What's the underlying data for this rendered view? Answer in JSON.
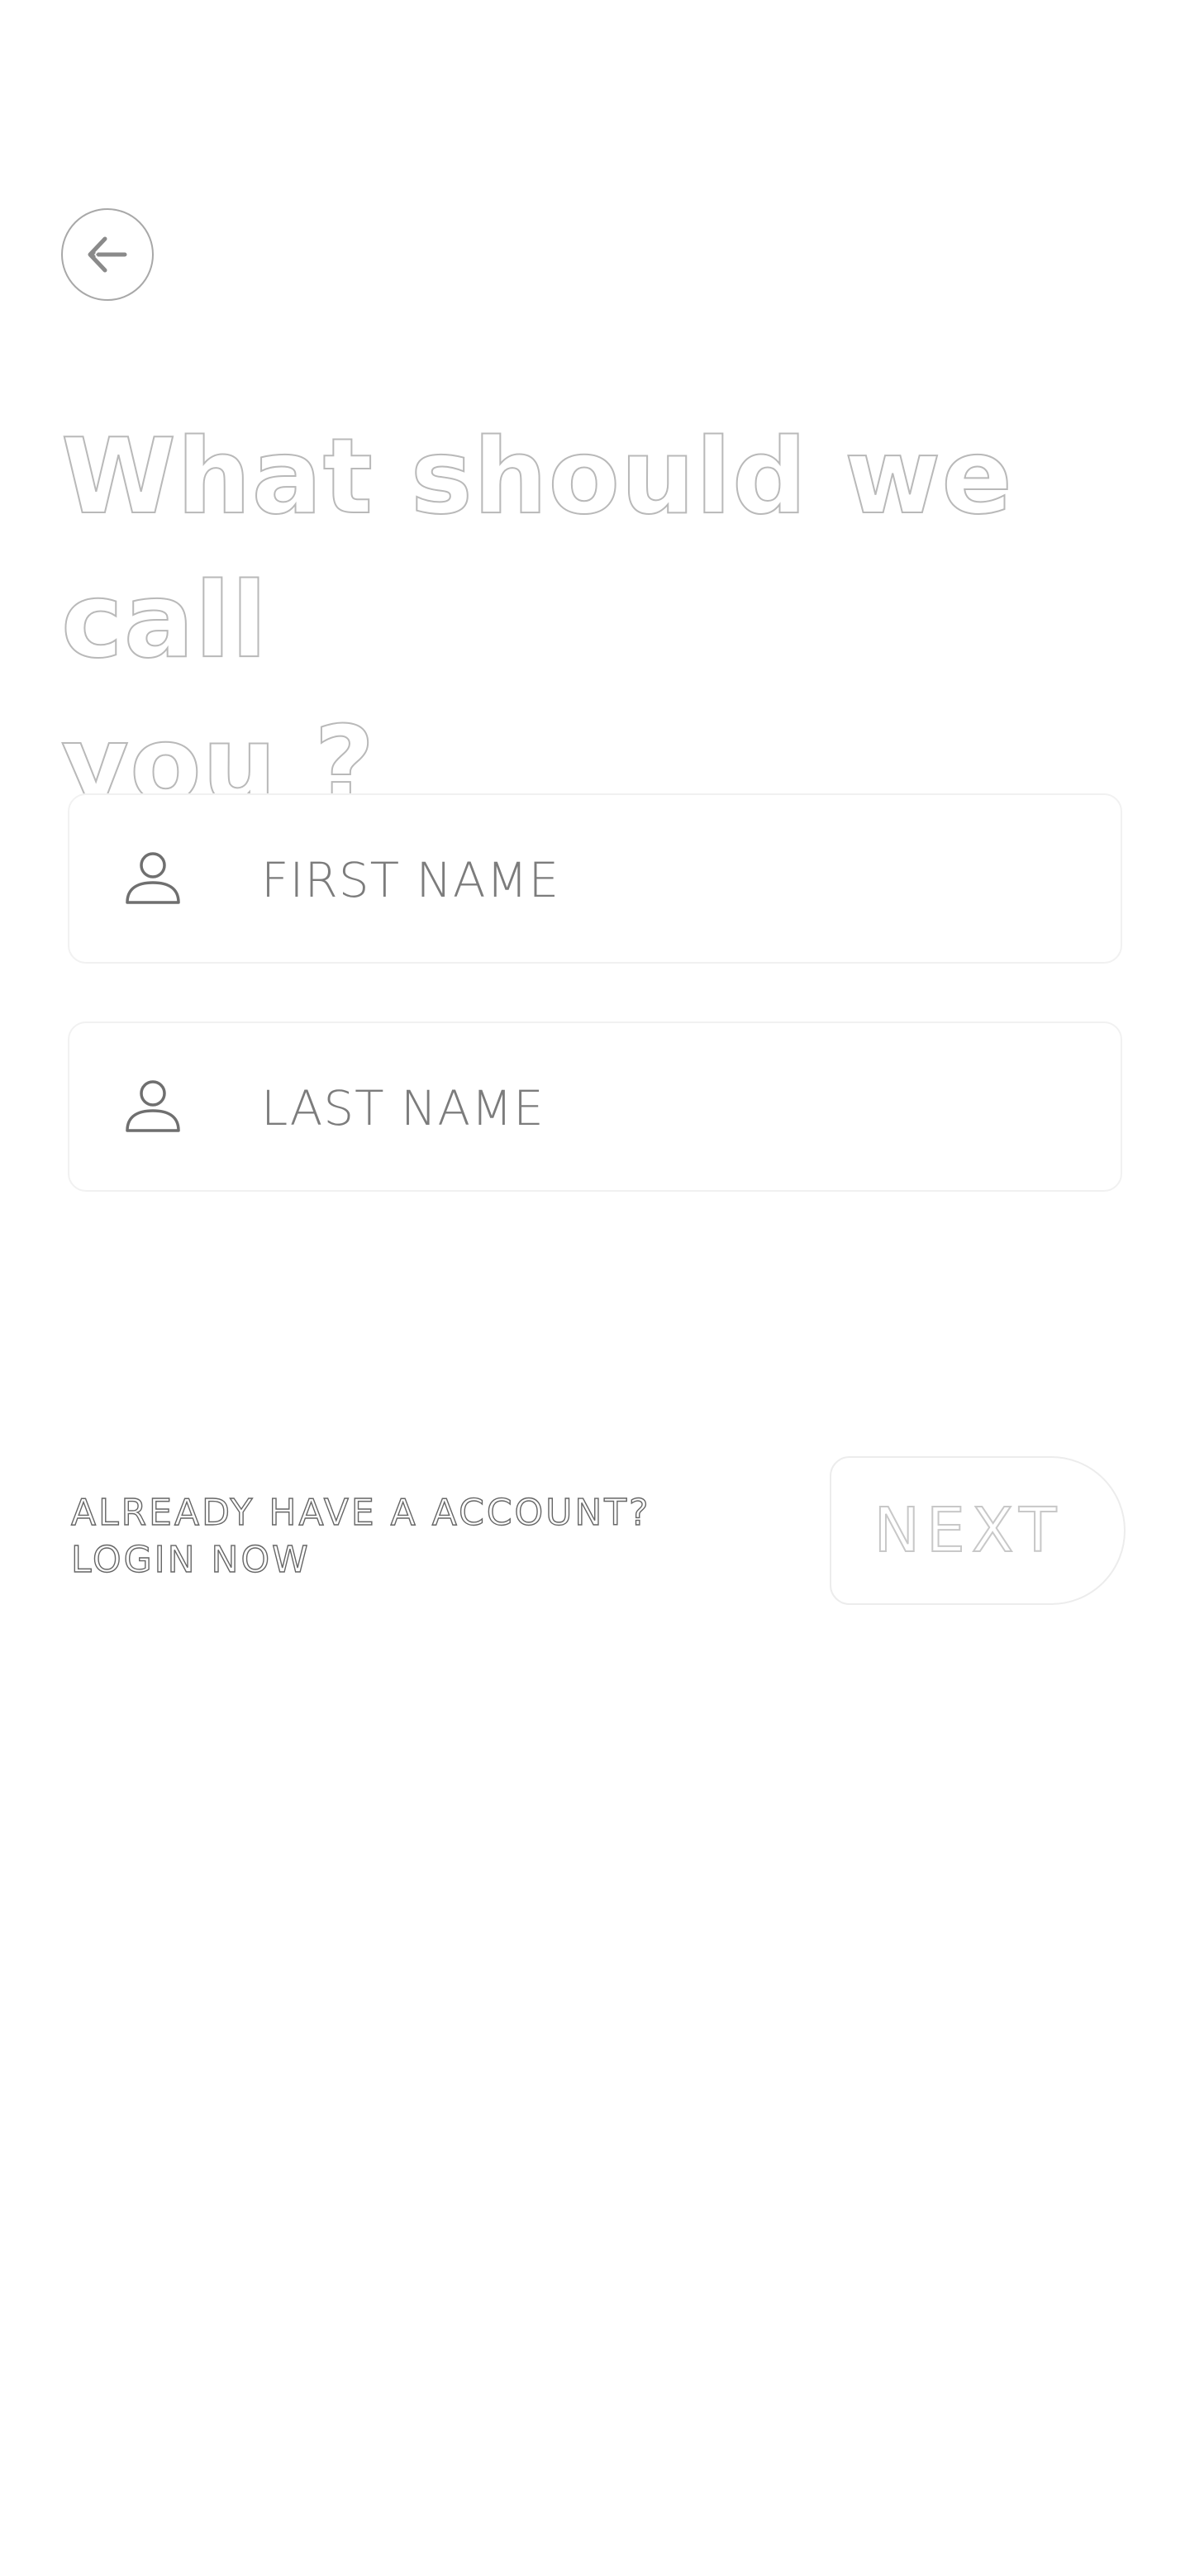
{
  "back_button": {
    "icon": "arrow-left-icon"
  },
  "title": {
    "text": "What should we call\n you ?"
  },
  "form": {
    "first_name": {
      "icon": "user-icon",
      "placeholder": "FIRST NAME",
      "value": ""
    },
    "last_name": {
      "icon": "user-icon",
      "placeholder": "LAST NAME",
      "value": ""
    }
  },
  "footer": {
    "account_question": "ALREADY HAVE A ACCOUNT?",
    "login_link": "LOGIN NOW",
    "next_label": "NEXT"
  },
  "colors": {
    "outline_text": "#b9b9b9",
    "placeholder": "#7c7c7c",
    "field_border": "#f1f1f1",
    "background": "#ffffff"
  }
}
